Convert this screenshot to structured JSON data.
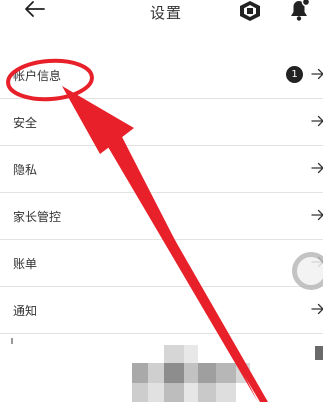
{
  "header": {
    "back_icon": "arrow-left-icon",
    "title": "设置",
    "currency_icon": "robux-icon",
    "notification_icon": "bell-icon"
  },
  "menu": {
    "items": [
      {
        "label": "帐户信息",
        "badge": "1",
        "icon": "arrow-right-icon"
      },
      {
        "label": "安全",
        "icon": "arrow-right-icon"
      },
      {
        "label": "隐私",
        "icon": "arrow-right-icon"
      },
      {
        "label": "家长管控",
        "icon": "arrow-right-icon"
      },
      {
        "label": "账单",
        "icon": "arrow-right-icon"
      },
      {
        "label": "通知",
        "icon": "arrow-right-icon"
      }
    ]
  },
  "annotation": {
    "color": "#e8202a",
    "shapes": [
      "circle-highlight",
      "pointer-arrow"
    ]
  },
  "overlay": {
    "floating_control": "scroll-knob",
    "redaction": "pixel-mosaic"
  }
}
